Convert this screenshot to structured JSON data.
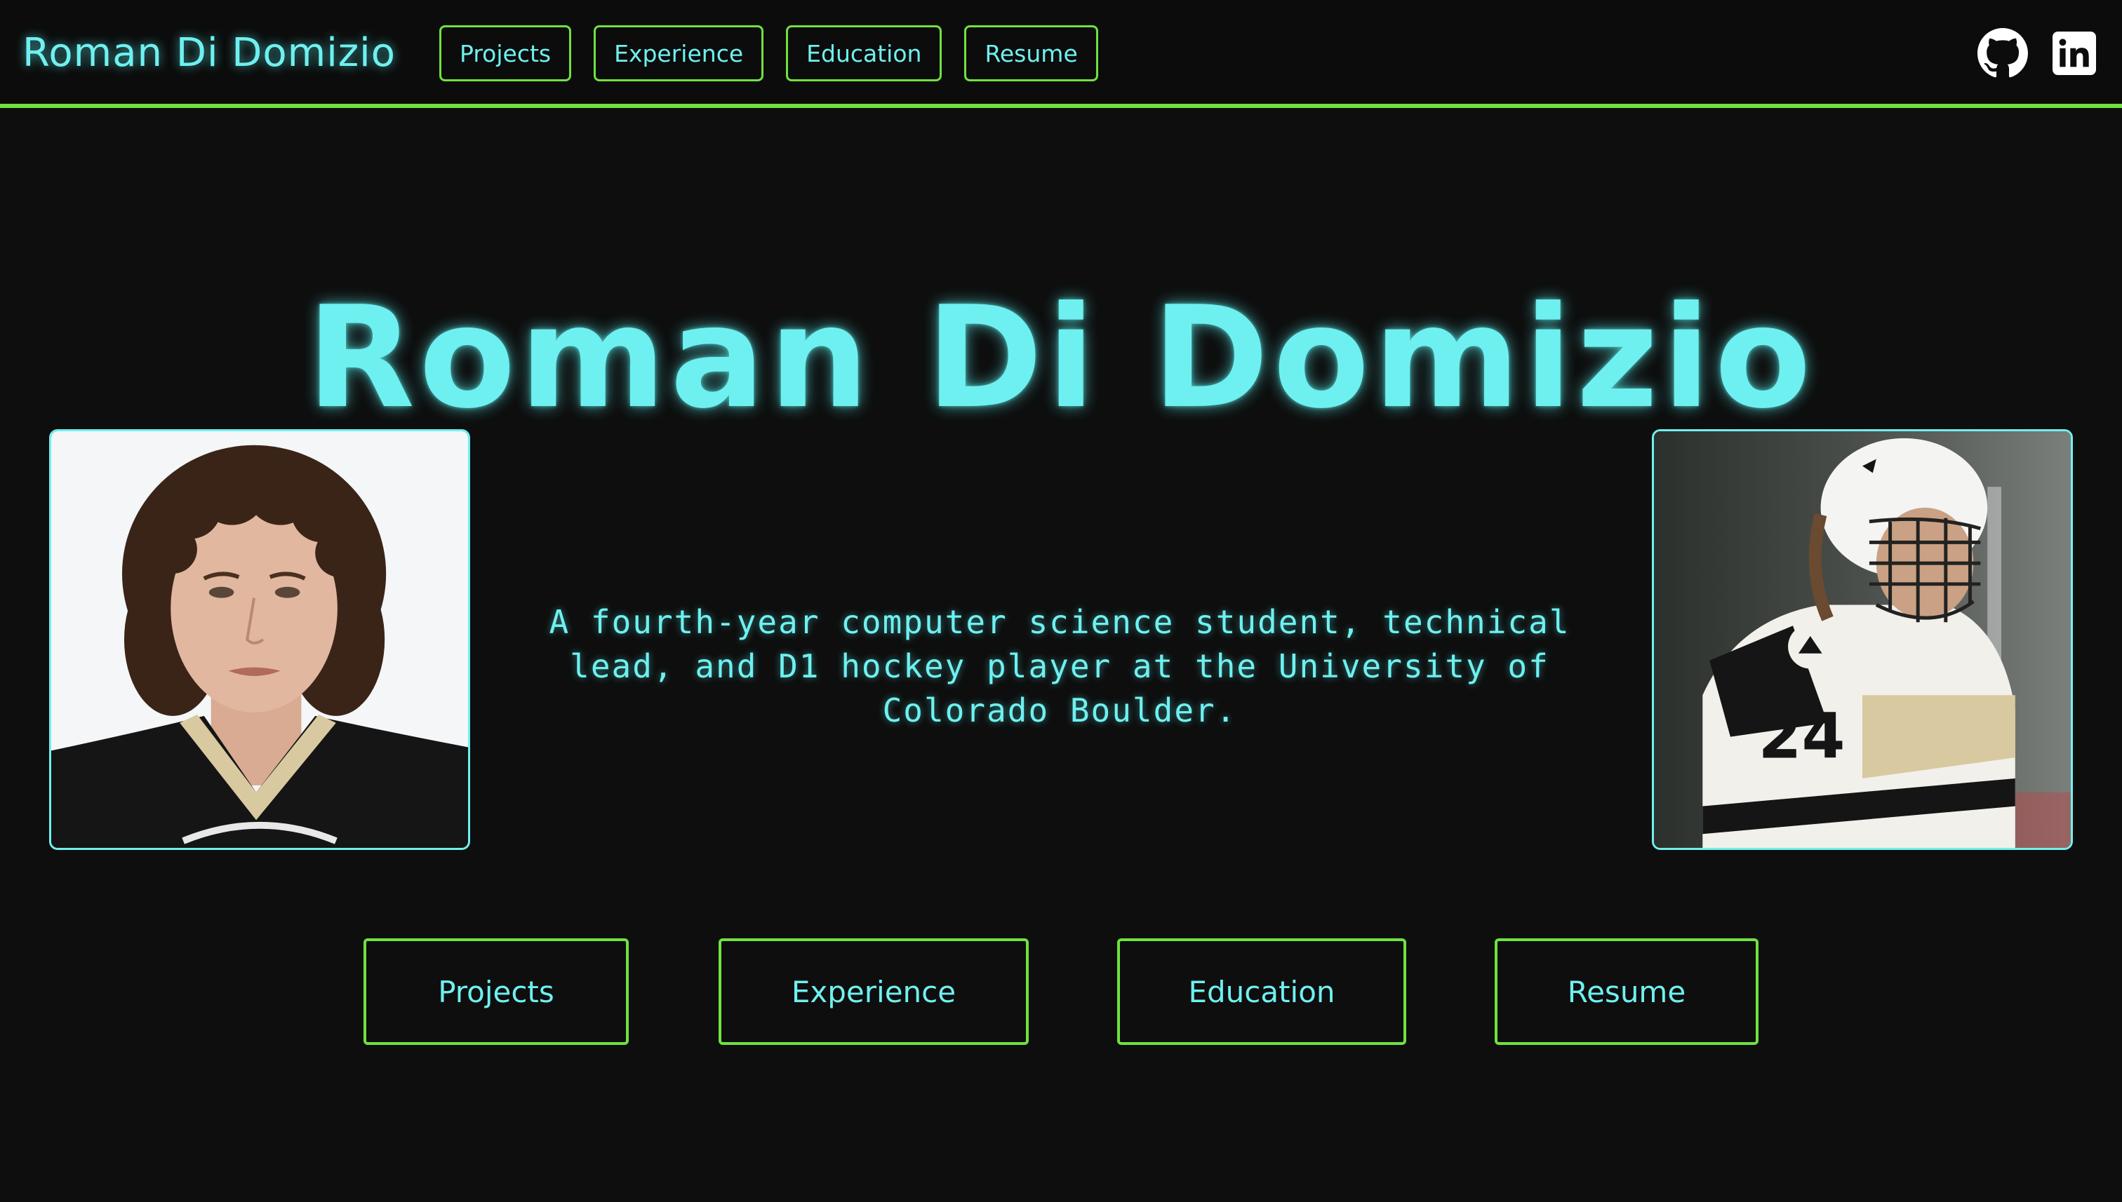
{
  "navbar": {
    "brand": "Roman Di Domizio",
    "links": [
      {
        "label": "Projects"
      },
      {
        "label": "Experience"
      },
      {
        "label": "Education"
      },
      {
        "label": "Resume"
      }
    ],
    "icons": [
      "github-icon",
      "linkedin-icon"
    ]
  },
  "hero": {
    "title": "Roman Di Domizio",
    "bio": "A fourth-year computer science student, technical lead, and D1 hockey player at the University of Colorado Boulder.",
    "photos": [
      "headshot-photo",
      "hockey-action-photo"
    ],
    "jersey_number": "24"
  },
  "cta_buttons": [
    {
      "label": "Projects"
    },
    {
      "label": "Experience"
    },
    {
      "label": "Education"
    },
    {
      "label": "Resume"
    }
  ],
  "colors": {
    "background": "#0e0e0e",
    "accent_cyan": "#6ff0f0",
    "accent_green": "#6fe23e"
  }
}
